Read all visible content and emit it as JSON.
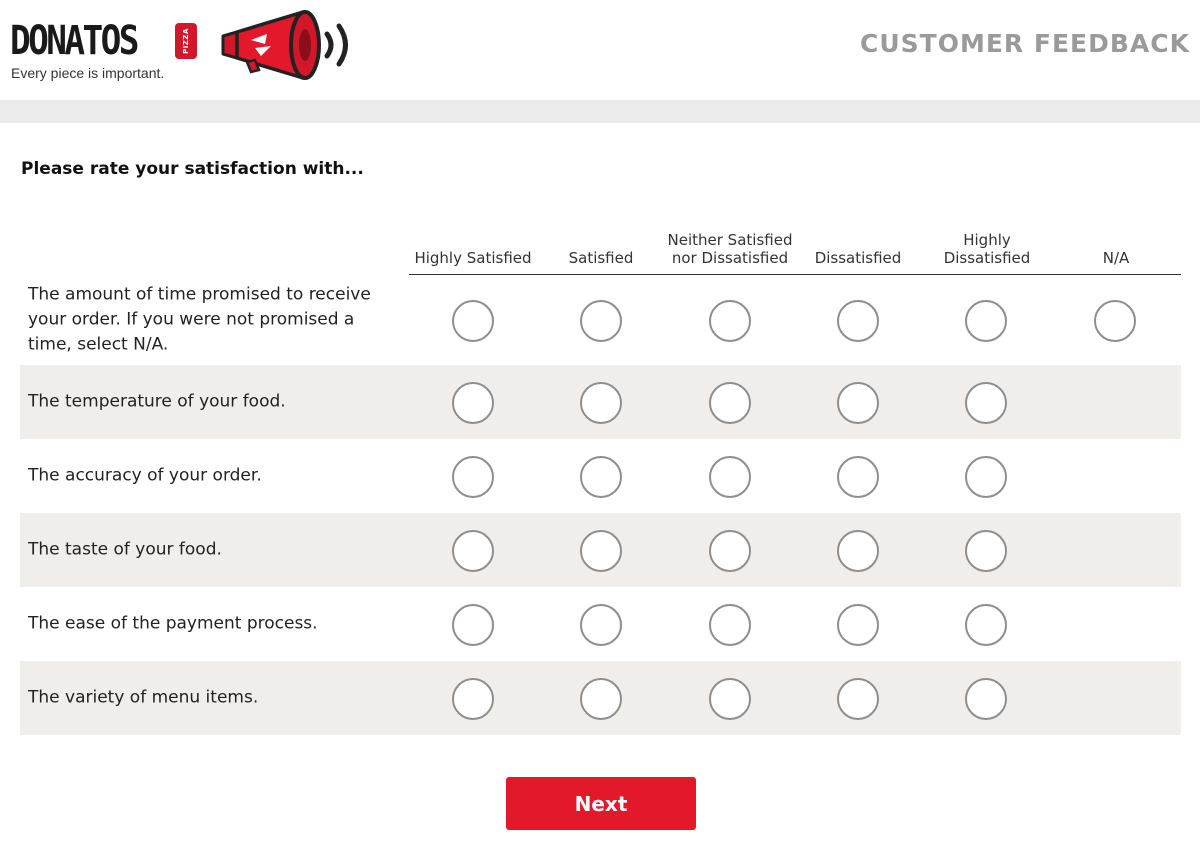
{
  "brand": {
    "name": "DONATOS",
    "badge": "PIZZA",
    "tagline": "Every piece is important."
  },
  "header": {
    "title": "CUSTOMER FEEDBACK"
  },
  "question": {
    "prompt": "Please rate your satisfaction with..."
  },
  "scale": [
    "Highly Satisfied",
    "Satisfied",
    "Neither Satisfied nor Dissatisfied",
    "Dissatisfied",
    "Highly Dissatisfied",
    "N/A"
  ],
  "rows": [
    {
      "label": "The amount of time promised to receive your order. If you were not promised a time, select N/A.",
      "has_na": true
    },
    {
      "label": "The temperature of your food.",
      "has_na": false
    },
    {
      "label": "The accuracy of your order.",
      "has_na": false
    },
    {
      "label": "The taste of your food.",
      "has_na": false
    },
    {
      "label": "The ease of the payment process.",
      "has_na": false
    },
    {
      "label": "The variety of menu items.",
      "has_na": false
    }
  ],
  "next_label": "Next",
  "colors": {
    "brand_red": "#e3192b",
    "header_gray": "#9a9a9a",
    "row_shade": "#efeeed"
  }
}
